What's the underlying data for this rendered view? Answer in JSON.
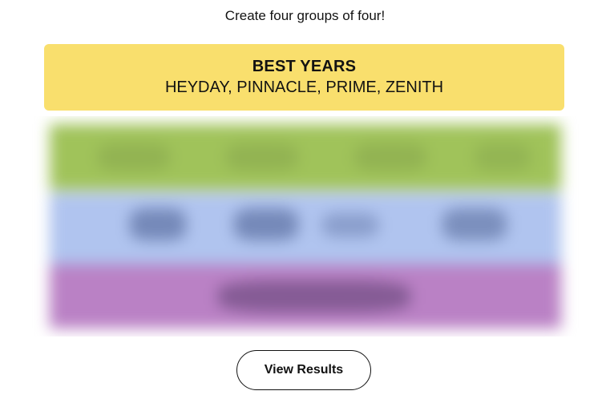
{
  "instructions": "Create four groups of four!",
  "solved_group": {
    "title": "BEST YEARS",
    "words": "HEYDAY, PINNACLE, PRIME, ZENITH",
    "color": "#f9df6d"
  },
  "hidden_groups": {
    "colors": [
      "#a0c35a",
      "#b0c4ef",
      "#ba81c5"
    ]
  },
  "actions": {
    "view_results_label": "View Results"
  }
}
